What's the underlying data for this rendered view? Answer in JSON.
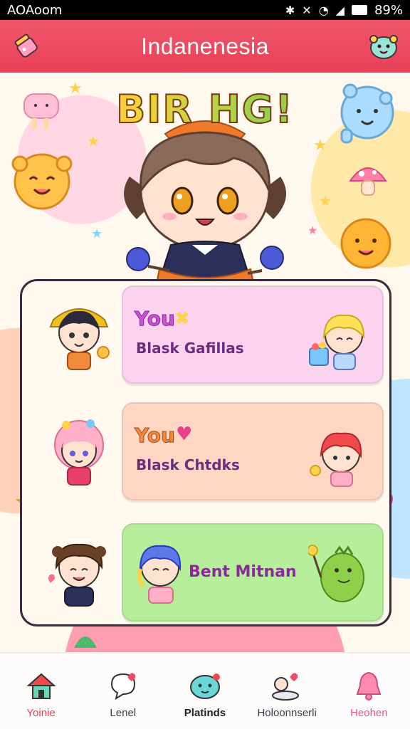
{
  "status": {
    "time": "AOAoom",
    "battery": "89%"
  },
  "header": {
    "title": "Indanenesia"
  },
  "hero": {
    "banner": "BIR HG!"
  },
  "cards": [
    {
      "title": "You",
      "subtitle": "Blask Gafillas"
    },
    {
      "title": "You",
      "subtitle": "Blask Chtdks"
    },
    {
      "subtitle": "Bent Mitnan"
    }
  ],
  "nav": [
    {
      "label": "Yoinie"
    },
    {
      "label": "Lenel"
    },
    {
      "label": "Platinds"
    },
    {
      "label": "Holoonnserli"
    },
    {
      "label": "Heohen"
    }
  ],
  "colors": {
    "accent": "#e84058",
    "card_pink": "#fbd3ef",
    "card_peach": "#ffd6c4",
    "card_green": "#b6ee9c"
  }
}
